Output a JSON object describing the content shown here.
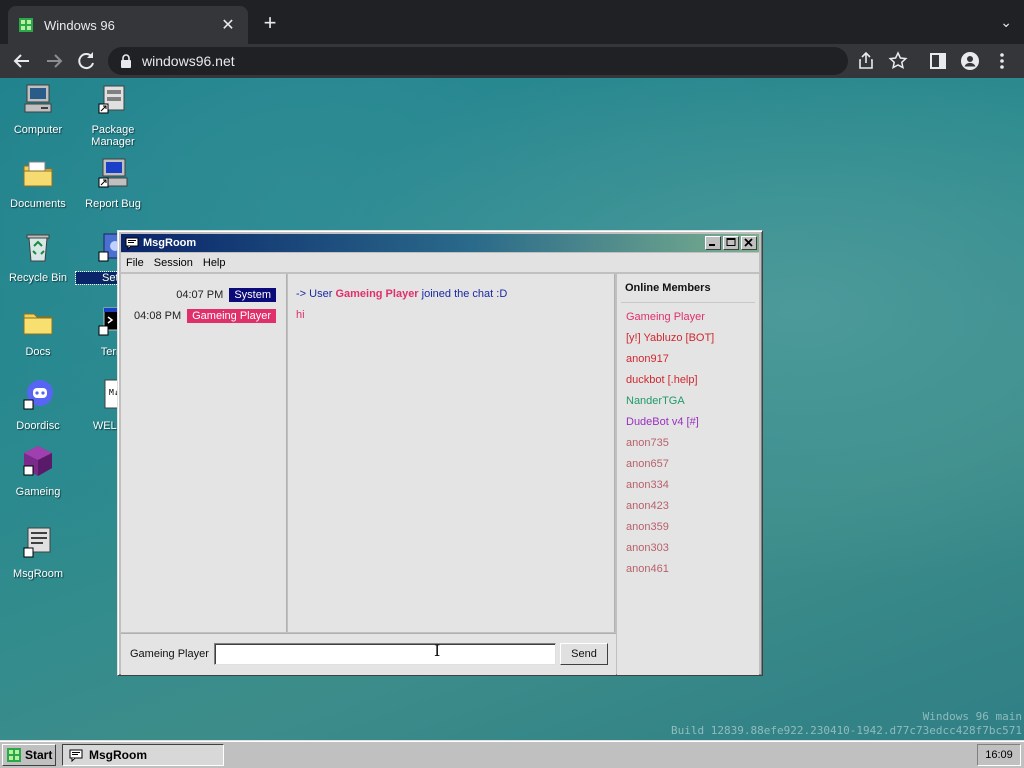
{
  "browser": {
    "tab_title": "Windows 96",
    "tab_close": "✕",
    "new_tab": "+",
    "tab_menu": "⌄",
    "url": "windows96.net"
  },
  "desktop": {
    "icons": [
      {
        "label": "Computer"
      },
      {
        "label": "Package Manager"
      },
      {
        "label": "Documents"
      },
      {
        "label": "Report Bug"
      },
      {
        "label": "Recycle Bin"
      },
      {
        "label": "Setti"
      },
      {
        "label": "Docs"
      },
      {
        "label": "Term"
      },
      {
        "label": "Doordisc"
      },
      {
        "label": "WELCO"
      },
      {
        "label": "Gameing"
      },
      {
        "label": "MsgRoom"
      }
    ],
    "watermark_line1": "Windows 96 main",
    "watermark_line2": "Build 12839.88efe922.230410-1942.d77c73edcc428f7bc571"
  },
  "msgroom": {
    "title": "MsgRoom",
    "menu": [
      "File",
      "Session",
      "Help"
    ],
    "messages": [
      {
        "time": "04:07 PM",
        "nick": "System",
        "nick_color": "#0a0a78",
        "text_prefix": "-> User ",
        "text_user": "Gameing Player",
        "text_suffix": " joined the chat :D"
      },
      {
        "time": "04:08 PM",
        "nick": "Gameing Player",
        "nick_color": "#e0306a",
        "text": "hi"
      }
    ],
    "members_heading": "Online Members",
    "members": [
      {
        "name": "Gameing Player",
        "color": "#e0306a"
      },
      {
        "name": "[y!] Yabluzo [BOT]",
        "color": "#d0282f"
      },
      {
        "name": "anon917",
        "color": "#d0282f"
      },
      {
        "name": "duckbot [.help]",
        "color": "#d0282f"
      },
      {
        "name": "NanderTGA",
        "color": "#1f9a6a"
      },
      {
        "name": "DudeBot v4 [#]",
        "color": "#9a2fc0"
      },
      {
        "name": "anon735",
        "color": "#b8606a"
      },
      {
        "name": "anon657",
        "color": "#b8606a"
      },
      {
        "name": "anon334",
        "color": "#b8606a"
      },
      {
        "name": "anon423",
        "color": "#b8606a"
      },
      {
        "name": "anon359",
        "color": "#b8606a"
      },
      {
        "name": "anon303",
        "color": "#b8606a"
      },
      {
        "name": "anon461",
        "color": "#b8606a"
      }
    ],
    "input_nick": "Gameing Player",
    "input_value": "",
    "send_label": "Send"
  },
  "taskbar": {
    "start_label": "Start",
    "task_label": "MsgRoom",
    "clock": "16:09"
  },
  "colors": {
    "system_text": "#1a2aa0",
    "user_highlight": "#e0306a"
  }
}
